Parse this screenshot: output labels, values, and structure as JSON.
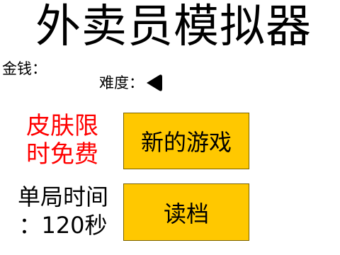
{
  "title": "外卖员模拟器",
  "money": {
    "label": "金钱："
  },
  "difficulty": {
    "label": "难度：",
    "icon": "difficulty-left-arrow-icon"
  },
  "promo": {
    "line1": "皮肤限",
    "line2": "时免费",
    "color": "#ff0000"
  },
  "timer": {
    "line1": "单局时间",
    "line2": "：120秒"
  },
  "buttons": {
    "new_game": "新的游戏",
    "load_game": "读档",
    "color": "#ffc800"
  }
}
